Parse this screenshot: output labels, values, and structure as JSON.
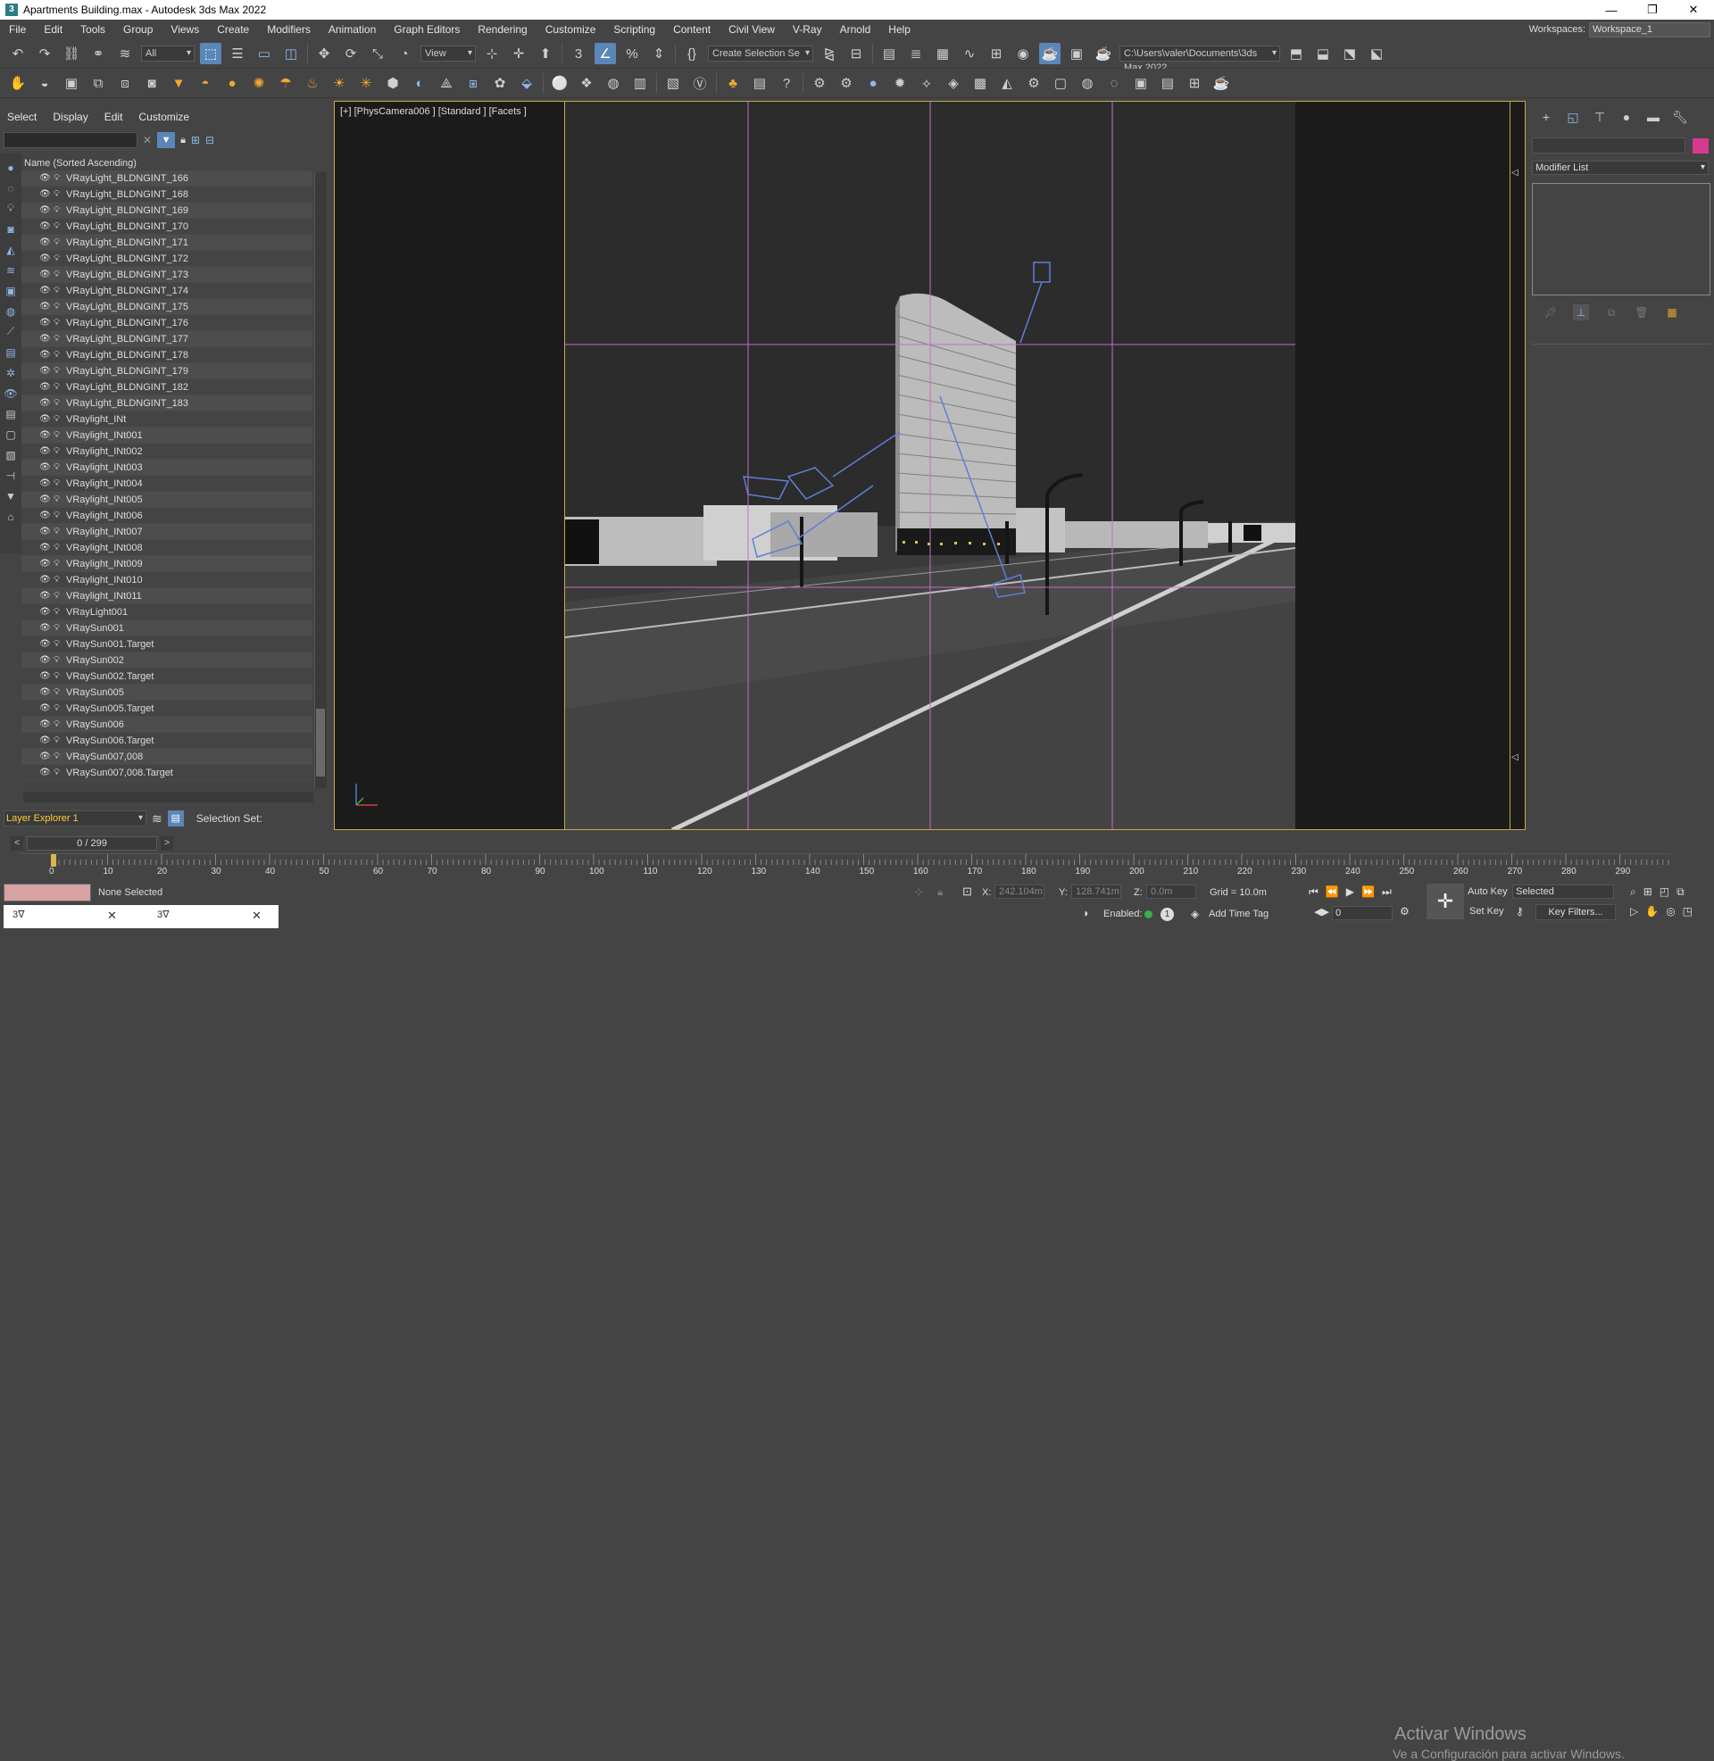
{
  "window": {
    "title": "Apartments Building.max - Autodesk 3ds Max 2022",
    "app_icon": "3",
    "minimize": "—",
    "restore": "❐",
    "close": "✕"
  },
  "menu": [
    "File",
    "Edit",
    "Tools",
    "Group",
    "Views",
    "Create",
    "Modifiers",
    "Animation",
    "Graph Editors",
    "Rendering",
    "Customize",
    "Scripting",
    "Content",
    "Civil View",
    "V-Ray",
    "Arnold",
    "Help"
  ],
  "workspaces": {
    "label": "Workspaces:",
    "value": "Workspace_1"
  },
  "toolbar1": {
    "filter": "All",
    "view": "View",
    "selection_set": "Create Selection Se",
    "path": "C:\\Users\\valer\\Documents\\3ds Max 2022"
  },
  "left_panel": {
    "tabs": [
      "Select",
      "Display",
      "Edit",
      "Customize"
    ],
    "column_header": "Name (Sorted Ascending)",
    "items": [
      "VRayLight_BLDNGINT_166",
      "VRayLight_BLDNGINT_168",
      "VRayLight_BLDNGINT_169",
      "VRayLight_BLDNGINT_170",
      "VRayLight_BLDNGINT_171",
      "VRayLight_BLDNGINT_172",
      "VRayLight_BLDNGINT_173",
      "VRayLight_BLDNGINT_174",
      "VRayLight_BLDNGINT_175",
      "VRayLight_BLDNGINT_176",
      "VRayLight_BLDNGINT_177",
      "VRayLight_BLDNGINT_178",
      "VRayLight_BLDNGINT_179",
      "VRayLight_BLDNGINT_182",
      "VRayLight_BLDNGINT_183",
      "VRaylight_INt",
      "VRaylight_INt001",
      "VRaylight_INt002",
      "VRaylight_INt003",
      "VRaylight_INt004",
      "VRaylight_INt005",
      "VRaylight_INt006",
      "VRaylight_INt007",
      "VRaylight_INt008",
      "VRaylight_INt009",
      "VRaylight_INt010",
      "VRaylight_INt011",
      "VRayLight001",
      "VRaySun001",
      "VRaySun001.Target",
      "VRaySun002",
      "VRaySun002.Target",
      "VRaySun005",
      "VRaySun005.Target",
      "VRaySun006",
      "VRaySun006.Target",
      "VRaySun007,008",
      "VRaySun007,008.Target"
    ],
    "layer_explorer": "Layer Explorer 1",
    "selection_set_label": "Selection Set:"
  },
  "viewport": {
    "label": "[+] [PhysCamera006 ] [Standard ] [Facets ]"
  },
  "command_panel": {
    "modifier_list": "Modifier List",
    "object_color": "#d63a8e"
  },
  "time": {
    "slider": "0 / 299",
    "ticks": [
      "0",
      "10",
      "20",
      "30",
      "40",
      "50",
      "60",
      "70",
      "80",
      "90",
      "100",
      "110",
      "120",
      "130",
      "140",
      "150",
      "160",
      "170",
      "180",
      "190",
      "200",
      "210",
      "220",
      "230",
      "240",
      "250",
      "260",
      "270",
      "280",
      "290"
    ]
  },
  "status": {
    "none_selected": "None Selected",
    "x_label": "X:",
    "x_value": "242.104m",
    "y_label": "Y:",
    "y_value": "128.741m",
    "z_label": "Z:",
    "z_value": "0.0m",
    "grid": "Grid = 10.0m",
    "enabled": "Enabled:",
    "add_time_tag": "Add Time Tag",
    "auto_key": "Auto Key",
    "selected": "Selected",
    "set_key": "Set Key",
    "key_filters": "Key Filters...",
    "frame": "0",
    "tab1": "3ᐁ",
    "tab2": "3ᐁ",
    "watermark_1": "Activar Windows",
    "watermark_2": "Ve a Configuración para activar Windows."
  }
}
